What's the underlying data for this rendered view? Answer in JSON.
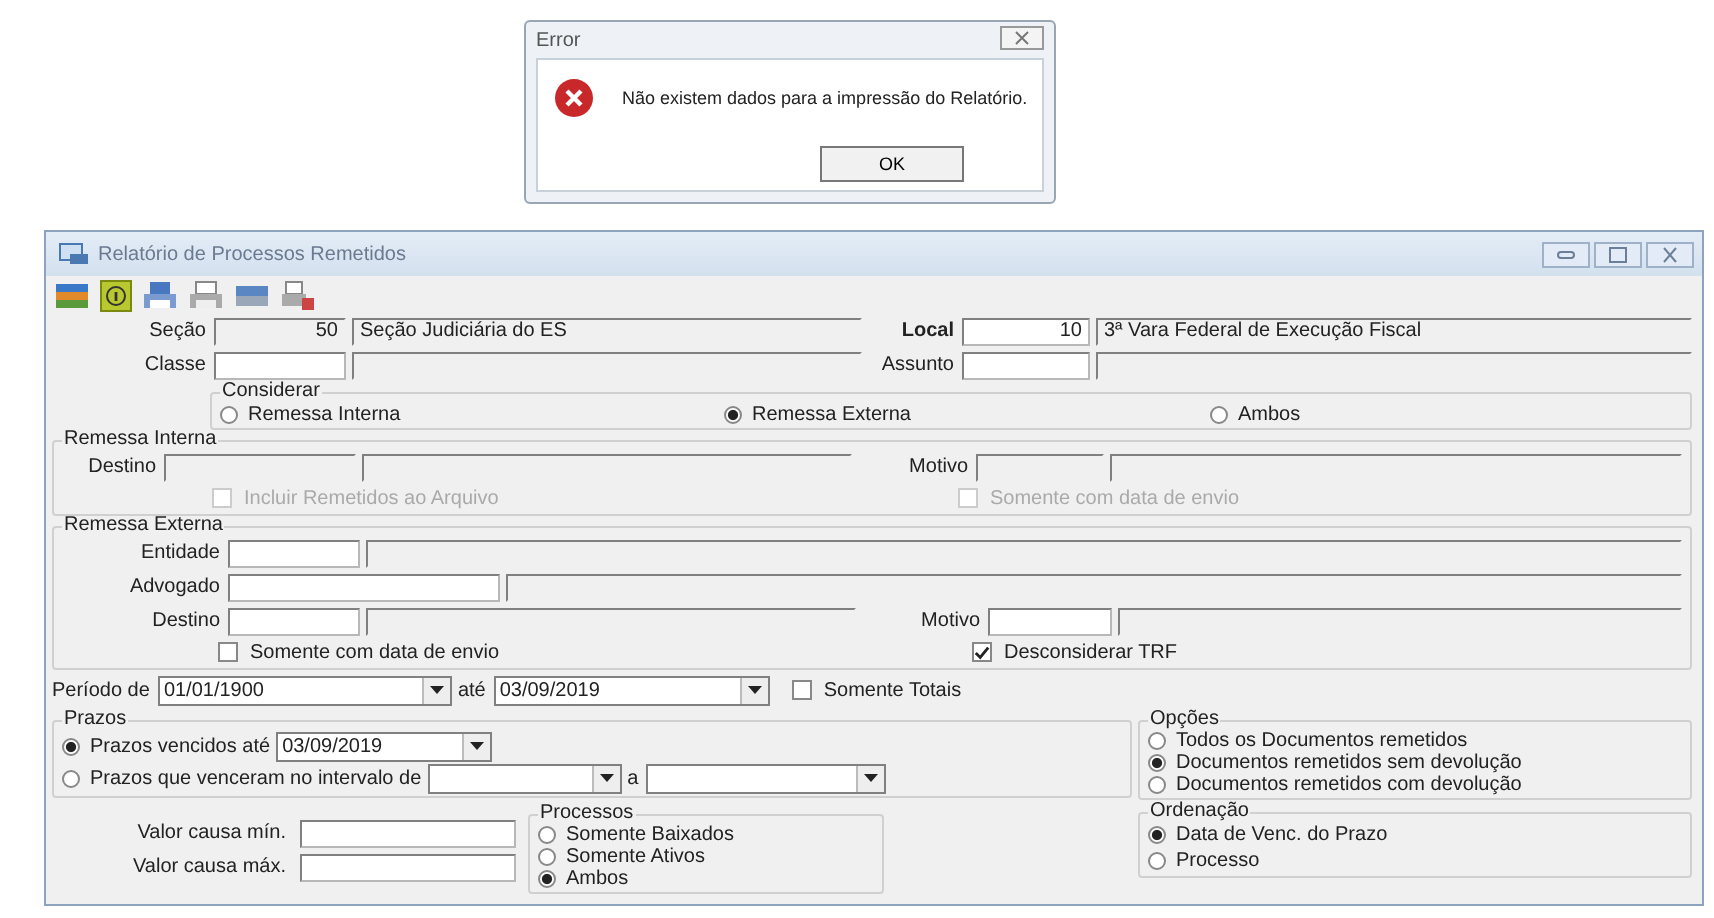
{
  "error_dialog": {
    "title": "Error",
    "message": "Não existem dados para a impressão do Relatório.",
    "button": "OK"
  },
  "window": {
    "title": "Relatório de Processos Remetidos"
  },
  "secao": {
    "label": "Seção",
    "code": "50",
    "name": "Seção Judiciária do ES"
  },
  "local": {
    "label": "Local",
    "code": "10",
    "name": "3ª Vara Federal de Execução Fiscal"
  },
  "classe": {
    "label": "Classe"
  },
  "assunto": {
    "label": "Assunto"
  },
  "considerar": {
    "title": "Considerar",
    "options": [
      {
        "label": "Remessa Interna",
        "selected": false
      },
      {
        "label": "Remessa Externa",
        "selected": true
      },
      {
        "label": "Ambos",
        "selected": false
      }
    ]
  },
  "remessa_interna": {
    "title": "Remessa Interna",
    "destino": "Destino",
    "motivo": "Motivo",
    "disabled": true,
    "checkboxes": [
      {
        "label": "Incluir Remetidos ao Arquivo",
        "checked": false
      },
      {
        "label": "Somente com data de envio",
        "checked": false
      }
    ]
  },
  "remessa_externa": {
    "title": "Remessa Externa",
    "entidade": "Entidade",
    "advogado": "Advogado",
    "destino": "Destino",
    "motivo": "Motivo",
    "checkboxes": [
      {
        "label": "Somente com data de envio",
        "checked": false
      },
      {
        "label": "Desconsiderar TRF",
        "checked": true
      }
    ]
  },
  "periodo": {
    "label": "Período de",
    "from": "01/01/1900",
    "until_label": "até",
    "to": "03/09/2019",
    "totals": {
      "label": "Somente Totais",
      "checked": false
    }
  },
  "prazos": {
    "title": "Prazos",
    "options": [
      {
        "label": "Prazos vencidos até",
        "selected": true,
        "date": "03/09/2019"
      },
      {
        "label": "Prazos que venceram no intervalo de",
        "selected": false,
        "to_label": "a"
      }
    ]
  },
  "opcoes": {
    "title": "Opções",
    "options": [
      {
        "label": "Todos os Documentos remetidos",
        "selected": false
      },
      {
        "label": "Documentos remetidos sem devolução",
        "selected": true
      },
      {
        "label": "Documentos remetidos com devolução",
        "selected": false
      }
    ]
  },
  "valor": {
    "min_label": "Valor causa mín.",
    "max_label": "Valor causa máx."
  },
  "processos": {
    "title": "Processos",
    "options": [
      {
        "label": "Somente Baixados",
        "selected": false
      },
      {
        "label": "Somente Ativos",
        "selected": false
      },
      {
        "label": "Ambos",
        "selected": true
      }
    ]
  },
  "ordenacao": {
    "title": "Ordenação",
    "options": [
      {
        "label": "Data de Venc. do Prazo",
        "selected": true
      },
      {
        "label": "Processo",
        "selected": false
      }
    ]
  }
}
